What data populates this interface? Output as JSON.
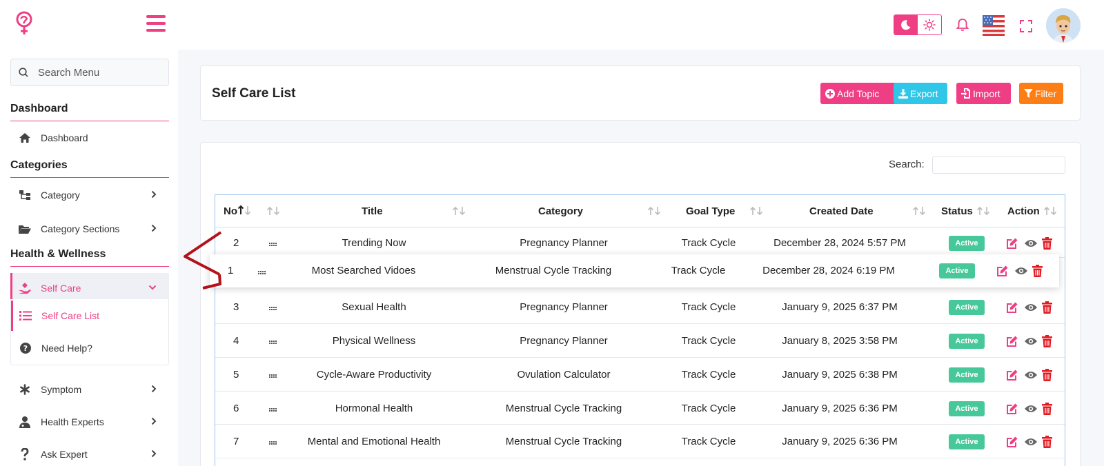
{
  "sidebar": {
    "search_placeholder": "Search Menu",
    "sections": {
      "dashboard": "Dashboard",
      "categories": "Categories",
      "health": "Health & Wellness"
    },
    "items": {
      "dashboard": "Dashboard",
      "category": "Category",
      "category_sections": "Category Sections",
      "self_care": "Self Care",
      "self_care_list": "Self Care List",
      "need_help": "Need Help?",
      "symptom": "Symptom",
      "health_experts": "Health Experts",
      "ask_expert": "Ask Expert"
    }
  },
  "header": {
    "title": "Self Care List",
    "buttons": {
      "add_topic": "Add Topic",
      "export": "Export",
      "import": "Import",
      "filter": "Filter"
    }
  },
  "table": {
    "search_label": "Search:",
    "columns": {
      "no": "No",
      "title": "Title",
      "category": "Category",
      "goal_type": "Goal Type",
      "created_date": "Created Date",
      "status": "Status",
      "action": "Action"
    },
    "rows": [
      {
        "no": "2",
        "title": "Trending Now",
        "category": "Pregnancy Planner",
        "goal_type": "Track Cycle",
        "created": "December 28, 2024 5:57 PM",
        "status": "Active"
      },
      {
        "no": "1",
        "title": "Most Searched Vidoes",
        "category": "Menstrual Cycle Tracking",
        "goal_type": "Track Cycle",
        "created": "December 28, 2024 6:19 PM",
        "status": "Active"
      },
      {
        "no": "3",
        "title": "Sexual Health",
        "category": "Pregnancy Planner",
        "goal_type": "Track Cycle",
        "created": "January 9, 2025 6:37 PM",
        "status": "Active"
      },
      {
        "no": "4",
        "title": "Physical Wellness",
        "category": "Pregnancy Planner",
        "goal_type": "Track Cycle",
        "created": "January 8, 2025 3:58 PM",
        "status": "Active"
      },
      {
        "no": "5",
        "title": "Cycle-Aware Productivity",
        "category": "Ovulation Calculator",
        "goal_type": "Track Cycle",
        "created": "January 9, 2025 6:38 PM",
        "status": "Active"
      },
      {
        "no": "6",
        "title": "Hormonal Health",
        "category": "Menstrual Cycle Tracking",
        "goal_type": "Track Cycle",
        "created": "January 9, 2025 6:36 PM",
        "status": "Active"
      },
      {
        "no": "7",
        "title": "Mental and Emotional Health",
        "category": "Menstrual Cycle Tracking",
        "goal_type": "Track Cycle",
        "created": "January 9, 2025 6:36 PM",
        "status": "Active"
      }
    ]
  },
  "colors": {
    "brand": "#ef3e83",
    "export": "#2fc6e8",
    "filter": "#fd7e14",
    "active_badge": "#46c89b",
    "drag_annotation": "#b3121b"
  }
}
